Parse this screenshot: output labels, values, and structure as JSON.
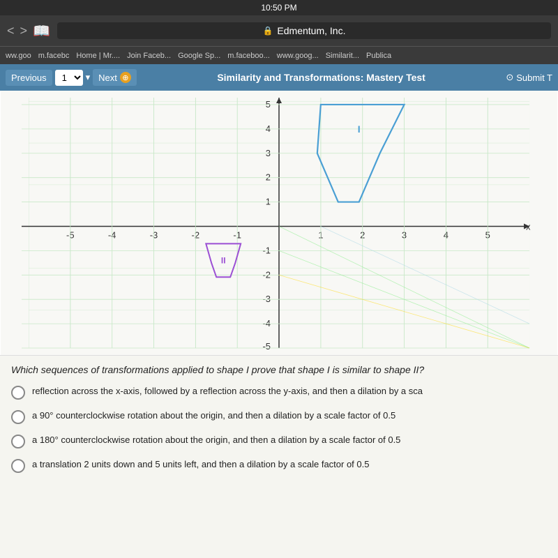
{
  "statusBar": {
    "time": "10:50 PM"
  },
  "browser": {
    "addressBar": {
      "domain": "Edmentum, Inc.",
      "lockLabel": "🔒"
    },
    "bookmarks": [
      "ww.goo",
      "m.facebc",
      "Home | Mr....",
      "Join Faceb...",
      "Google Sp...",
      "m.faceboo...",
      "www.goog...",
      "Similarit...",
      "Publica"
    ]
  },
  "navigation": {
    "prevLabel": "Previous",
    "pageNumber": "1",
    "nextLabel": "Next",
    "pageTitle": "Similarity and Transformations: Mastery Test",
    "submitLabel": "Submit T"
  },
  "graph": {
    "shapeILabel": "I",
    "shapeIILabel": "II"
  },
  "question": {
    "text": "Which sequences of transformations applied to shape I prove that shape I is similar to shape II?",
    "options": [
      "reflection across the x-axis, followed by a reflection across the y-axis, and then a dilation by a sca",
      "a 90° counterclockwise rotation about the origin, and then a dilation by a scale factor of 0.5",
      "a 180° counterclockwise rotation about the origin, and then a dilation by a scale factor of 0.5",
      "a translation 2 units down and 5 units left, and then a dilation by a scale factor of 0.5"
    ]
  }
}
